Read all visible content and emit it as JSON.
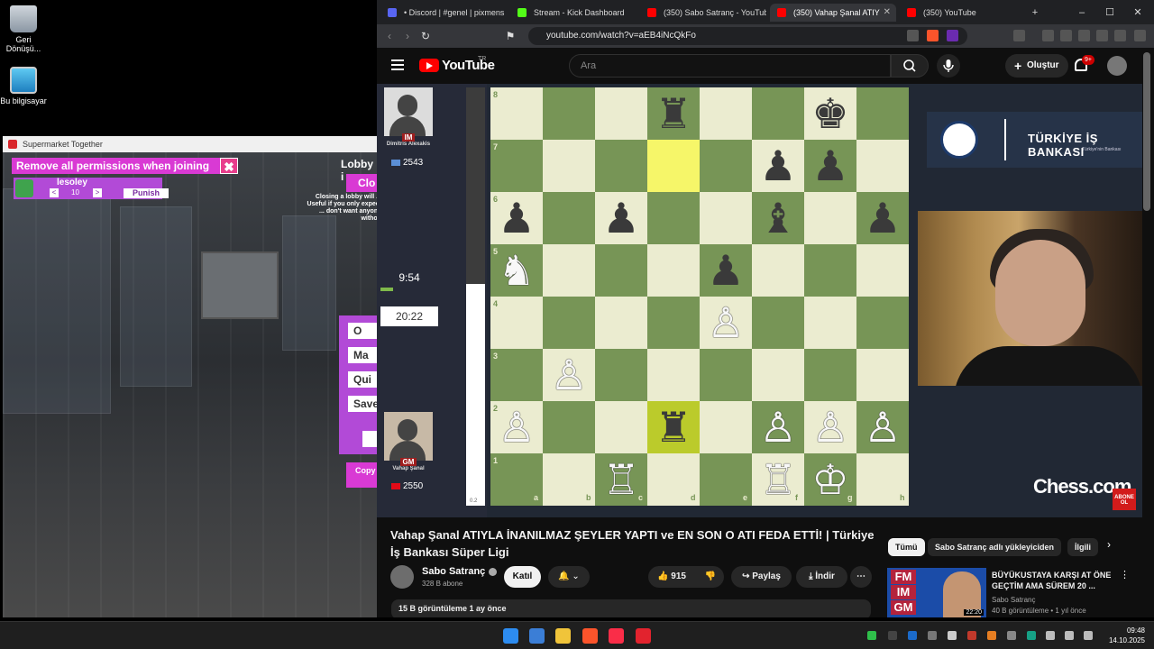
{
  "desktop": {
    "icons": [
      {
        "label": "Geri Dönüşü...",
        "icon": "recycle-bin-icon"
      },
      {
        "label": "Bu bilgisayar",
        "icon": "this-pc-icon"
      }
    ]
  },
  "game_window": {
    "title": "Supermarket Together",
    "permission_banner": "Remove all permissions when joining",
    "close_symbol": "✖",
    "player": {
      "name": "lesoley",
      "value": "10",
      "punish_label": "Punish",
      "prev": "<",
      "next": ">"
    },
    "lobby_title": "Lobby i",
    "lobby_close": "Clo",
    "lobby_note": "Closing a lobby will ... Useful if you only expect ... don't want anyone withou",
    "menu": [
      "O",
      "Ma",
      "Qui",
      "Save"
    ],
    "copy_label": "Copy l"
  },
  "browser": {
    "tabs": [
      {
        "label": "• Discord | #genel | pixmens",
        "color": "#5865f2",
        "active": false
      },
      {
        "label": "Stream - Kick Dashboard",
        "color": "#53fc18",
        "active": false
      },
      {
        "label": "(350) Sabo Satranç - YouTube",
        "color": "#ff0000",
        "active": false
      },
      {
        "label": "(350) Vahap Şanal ATIY",
        "color": "#ff0000",
        "active": true
      },
      {
        "label": "(350) YouTube",
        "color": "#ff0000",
        "active": false
      }
    ],
    "new_tab": "+",
    "window_controls": {
      "minimize": "–",
      "maximize": "☐",
      "close": "✕"
    },
    "url": "youtube.com/watch?v=aEB4iNcQkFo"
  },
  "youtube": {
    "logo_text": "YouTube",
    "logo_region": "TR",
    "search_placeholder": "Ara",
    "create_label": "Oluştur",
    "notification_badge": "9+",
    "video": {
      "top_player": {
        "name": "Dimitris Alexakis",
        "title": "IM",
        "rating": "2543",
        "clock": "9:54"
      },
      "bottom_player": {
        "name": "Vahap Şanal",
        "title": "GM",
        "rating": "2550",
        "clock": "20:22"
      },
      "eval": "0.2",
      "eval_white_fraction": 0.53,
      "files": [
        "a",
        "b",
        "c",
        "d",
        "e",
        "f",
        "g",
        "h"
      ],
      "ranks": [
        "8",
        "7",
        "6",
        "5",
        "4",
        "3",
        "2",
        "1"
      ],
      "highlighted_squares": [
        "d7",
        "d2"
      ],
      "pieces": [
        {
          "sq": "d8",
          "glyph": "♜",
          "color": "b"
        },
        {
          "sq": "g8",
          "glyph": "♚",
          "color": "b"
        },
        {
          "sq": "f7",
          "glyph": "♟",
          "color": "b"
        },
        {
          "sq": "g7",
          "glyph": "♟",
          "color": "b"
        },
        {
          "sq": "a6",
          "glyph": "♟",
          "color": "b"
        },
        {
          "sq": "c6",
          "glyph": "♟",
          "color": "b"
        },
        {
          "sq": "f6",
          "glyph": "♝",
          "color": "b"
        },
        {
          "sq": "h6",
          "glyph": "♟",
          "color": "b"
        },
        {
          "sq": "a5",
          "glyph": "♞",
          "color": "w"
        },
        {
          "sq": "e5",
          "glyph": "♟",
          "color": "b"
        },
        {
          "sq": "e4",
          "glyph": "♙",
          "color": "w"
        },
        {
          "sq": "b3",
          "glyph": "♙",
          "color": "w"
        },
        {
          "sq": "a2",
          "glyph": "♙",
          "color": "w"
        },
        {
          "sq": "d2",
          "glyph": "♜",
          "color": "b"
        },
        {
          "sq": "f2",
          "glyph": "♙",
          "color": "w"
        },
        {
          "sq": "g2",
          "glyph": "♙",
          "color": "w"
        },
        {
          "sq": "h2",
          "glyph": "♙",
          "color": "w"
        },
        {
          "sq": "c1",
          "glyph": "♖",
          "color": "w"
        },
        {
          "sq": "f1",
          "glyph": "♖",
          "color": "w"
        },
        {
          "sq": "g1",
          "glyph": "♔",
          "color": "w"
        }
      ],
      "sponsor_name": "TÜRKİYE İŞ BANKASI",
      "sponsor_sub": "Türkiye'nin Bankası",
      "brand": "Chess.com",
      "subscribe_overlay": "ABONE OL"
    },
    "title": "Vahap Şanal ATIYLA İNANILMAZ ŞEYLER YAPTI ve EN SON O ATI FEDA ETTİ! | Türkiye İş Bankası Süper Ligi",
    "channel": {
      "name": "Sabo Satranç",
      "subs": "328 B abone",
      "join": "Katıl",
      "bell": "🔔 ⌄"
    },
    "actions": {
      "likes": "915",
      "share": "Paylaş",
      "download": "İndir",
      "more": "⋯"
    },
    "description": "15 B görüntüleme   1 ay önce",
    "chips": [
      "Tümü",
      "Sabo Satranç adlı yükleyiciden",
      "İlgili"
    ],
    "recommendation": {
      "title": "BÜYÜKUSTAYA KARŞI AT ÖNE GEÇTİM AMA SÜREM 20 ...",
      "channel": "Sabo Satranç",
      "meta": "40 B görüntüleme • 1 yıl önce",
      "tags": [
        "FM",
        "IM",
        "GM"
      ],
      "duration": "22:20"
    }
  },
  "taskbar": {
    "time": "09:48",
    "date": "14.10.2025",
    "apps": [
      {
        "name": "start-icon",
        "color": "#2d8cf0"
      },
      {
        "name": "weather-icon",
        "color": "#3b7ed6"
      },
      {
        "name": "file-explorer-icon",
        "color": "#f0c43a"
      },
      {
        "name": "brave-icon",
        "color": "#fb542b"
      },
      {
        "name": "music-icon",
        "color": "#fa2d48"
      },
      {
        "name": "app-icon",
        "color": "#e2232e"
      }
    ]
  }
}
